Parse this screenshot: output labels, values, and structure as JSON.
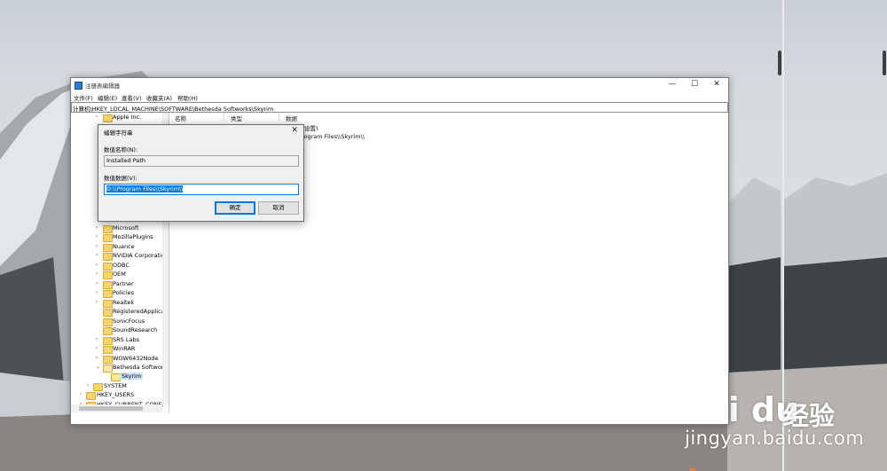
{
  "window": {
    "title": "注册表编辑器",
    "controls": {
      "minimize": "—",
      "maximize": "☐",
      "close": "✕"
    }
  },
  "menu": [
    "文件(F)",
    "编辑(E)",
    "查看(V)",
    "收藏夹(A)",
    "帮助(H)"
  ],
  "address": "计算机\\HKEY_LOCAL_MACHINE\\SOFTWARE\\Bethesda Softworks\\Skyrim",
  "tree": {
    "top_item": "Apple Inc.",
    "items": [
      "Microsoft",
      "MozillaPlugins",
      "Nuance",
      "NVIDIA Corporatio",
      "ODBC",
      "OEM",
      "Partner",
      "Policies",
      "Realtek",
      "RegisteredApplica",
      "SonicFocus",
      "SoundResearch",
      "SRS Labs",
      "WinRAR",
      "WOW6432Node",
      "Bethesda Softwork"
    ],
    "selected": "Skyrim",
    "root_items": [
      "SYSTEM",
      "HKEY_USERS",
      "HKEY_CURRENT_CONFI"
    ]
  },
  "list": {
    "columns": [
      "名称",
      "类型",
      "数据"
    ],
    "partial_values": [
      "设置)",
      "rogram Files\\\\Skyrim\\\\"
    ]
  },
  "dialog": {
    "title": "编辑字符串",
    "name_label": "数值名称(N):",
    "name_value": "Installed Path",
    "data_label": "数值数据(V):",
    "data_value": "D:\\\\Program Files\\\\Skyrim\\\\",
    "ok": "确定",
    "cancel": "取消",
    "close": "✕"
  },
  "watermark": {
    "logo": "Bai du",
    "brand_cn": "经验",
    "url": "jingyan.baidu.com"
  }
}
